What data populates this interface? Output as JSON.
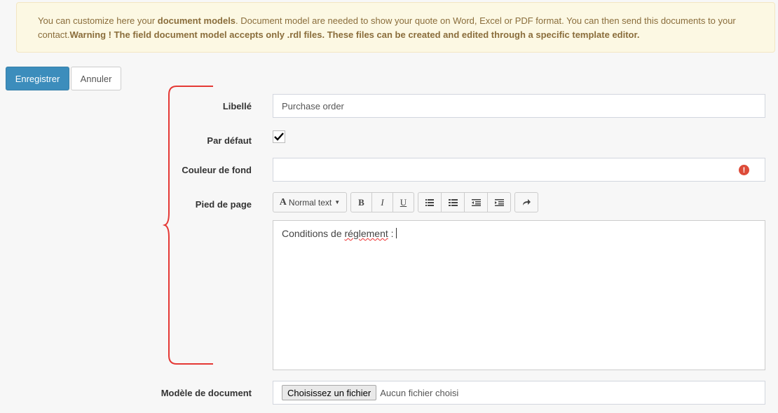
{
  "alert": {
    "text_1": "You can customize here your ",
    "bold_1": "document models",
    "text_2": ". Document model are needed to show your quote on Word, Excel or PDF format. You can then send this documents to your contact.",
    "bold_2": "Warning ! The field document model accepts only .rdl files. These files can be created and edited through a specific template editor."
  },
  "actions": {
    "save_label": "Enregistrer",
    "cancel_label": "Annuler"
  },
  "form": {
    "libelle_label": "Libellé",
    "libelle_value": "Purchase order",
    "default_label": "Par défaut",
    "default_checked": true,
    "bgcolor_label": "Couleur de fond",
    "bgcolor_value": "",
    "footer_label": "Pied de page",
    "footer_text_1": "Conditions de ",
    "footer_text_misspelled": "réglement",
    "footer_text_2": " :",
    "model_label": "Modèle de document",
    "file_button_label": "Choisissez un fichier",
    "file_status": "Aucun fichier choisi"
  },
  "editor_toolbar": {
    "format_label": "Normal text",
    "icons": [
      "text-format-icon",
      "bold-icon",
      "italic-icon",
      "underline-icon",
      "unordered-list-icon",
      "ordered-list-icon",
      "outdent-icon",
      "indent-icon",
      "redo-icon"
    ]
  },
  "colors": {
    "primary": "#3c8dbc",
    "alert_bg": "#fcf8e3",
    "alert_text": "#8a6d3b",
    "error": "#dd4b39",
    "annotation": "#e53935"
  }
}
